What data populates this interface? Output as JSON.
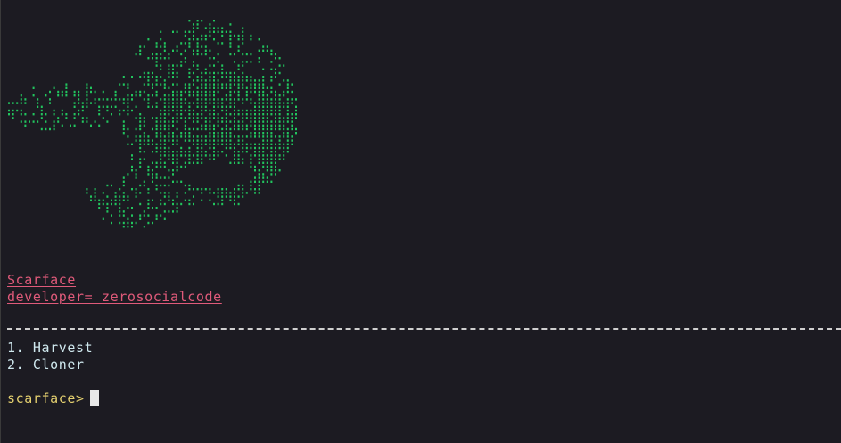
{
  "banner": {
    "title": "Scarface",
    "developer": "developer= zerosocialcode",
    "color": "#22c55e"
  },
  "menu": {
    "items": [
      {
        "label": "1. Harvest"
      },
      {
        "label": "2. Cloner"
      }
    ]
  },
  "prompt": {
    "text": "scarface>"
  }
}
